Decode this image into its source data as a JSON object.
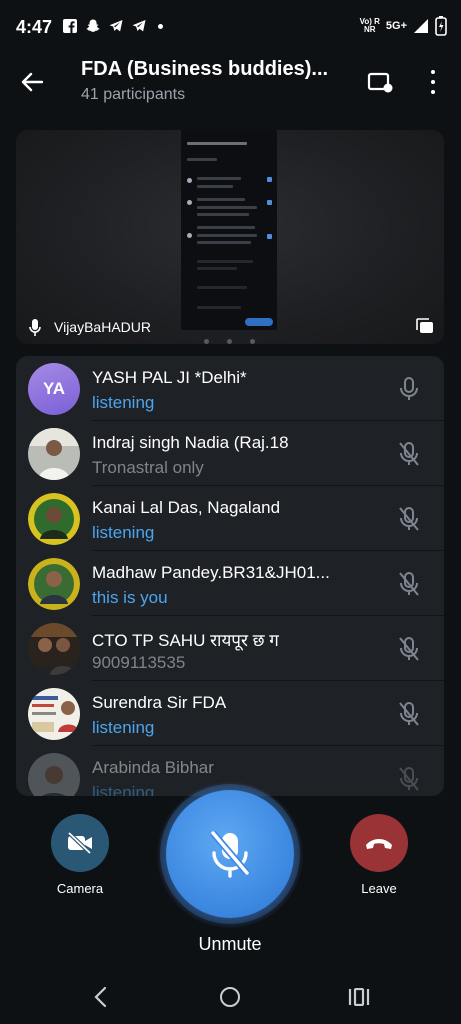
{
  "status_bar": {
    "time": "4:47",
    "network_top": "Vo) R",
    "network_bottom": "NR",
    "network_type": "5G+",
    "icons": [
      "facebook-icon",
      "snapchat-icon",
      "telegram-icon",
      "telegram-icon"
    ]
  },
  "header": {
    "title": "FDA (Business buddies)...",
    "subtitle": "41 participants"
  },
  "video": {
    "speaker_name": "VijayBaHADUR"
  },
  "participants": [
    {
      "name": "YASH PAL JI *Delhi*",
      "status": "listening",
      "status_color": "#4da5ee",
      "avatar_initials": "YA",
      "mic": "mic-icon"
    },
    {
      "name": "Indraj singh Nadia (Raj.18",
      "status": "Tronastral only",
      "status_color": "#7d858d",
      "mic": "mic-off-icon"
    },
    {
      "name": "Kanai Lal Das, Nagaland",
      "status": "listening",
      "status_color": "#4da5ee",
      "mic": "mic-off-icon"
    },
    {
      "name": "Madhaw Pandey.BR31&JH01...",
      "status": "this is you",
      "status_color": "#4da5ee",
      "mic": "mic-off-icon"
    },
    {
      "name": "CTO TP SAHU रायपूर छ ग",
      "status": "9009113535",
      "status_color": "#7d858d",
      "mic": "mic-off-icon"
    },
    {
      "name": "Surendra Sir FDA",
      "status": "listening",
      "status_color": "#4da5ee",
      "mic": "mic-off-icon"
    },
    {
      "name": "Arabinda Bibhar",
      "status": "listening",
      "status_color": "#4da5ee",
      "mic": "mic-off-icon"
    }
  ],
  "controls": {
    "camera_label": "Camera",
    "leave_label": "Leave",
    "unmute_label": "Unmute"
  },
  "colors": {
    "background": "#0e1114",
    "list_bg": "#1e2226",
    "accent_blue": "#4da5ee",
    "unmute_blue": "#3f8be3",
    "leave_red": "#9a3336",
    "camera_blue": "#2a5874"
  }
}
